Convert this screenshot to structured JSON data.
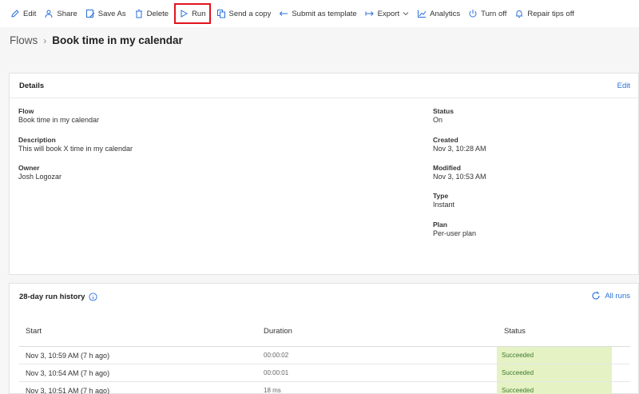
{
  "toolbar": {
    "edit": "Edit",
    "share": "Share",
    "save_as": "Save As",
    "delete": "Delete",
    "run": "Run",
    "send_copy": "Send a copy",
    "submit_template": "Submit as template",
    "export": "Export",
    "analytics": "Analytics",
    "turn_off": "Turn off",
    "repair_tips": "Repair tips off"
  },
  "breadcrumb": {
    "root": "Flows",
    "current": "Book time in my calendar"
  },
  "details": {
    "title": "Details",
    "edit_label": "Edit",
    "flow_label": "Flow",
    "flow_value": "Book time in my calendar",
    "description_label": "Description",
    "description_value": "This will book X time in my calendar",
    "owner_label": "Owner",
    "owner_value": "Josh Logozar",
    "status_label": "Status",
    "status_value": "On",
    "created_label": "Created",
    "created_value": "Nov 3, 10:28 AM",
    "modified_label": "Modified",
    "modified_value": "Nov 3, 10:53 AM",
    "type_label": "Type",
    "type_value": "Instant",
    "plan_label": "Plan",
    "plan_value": "Per-user plan"
  },
  "history": {
    "title": "28-day run history",
    "all_runs": "All runs",
    "columns": [
      "Start",
      "Duration",
      "Status"
    ],
    "rows": [
      {
        "start": "Nov 3, 10:59 AM (7 h ago)",
        "duration": "00:00:02",
        "status": "Succeeded"
      },
      {
        "start": "Nov 3, 10:54 AM (7 h ago)",
        "duration": "00:00:01",
        "status": "Succeeded"
      },
      {
        "start": "Nov 3, 10:51 AM (7 h ago)",
        "duration": "18 ms",
        "status": "Succeeded"
      }
    ]
  },
  "colors": {
    "accent": "#2a6fdb",
    "run_highlight": "#e0141e",
    "succeeded_bg": "#e5f2c4"
  }
}
